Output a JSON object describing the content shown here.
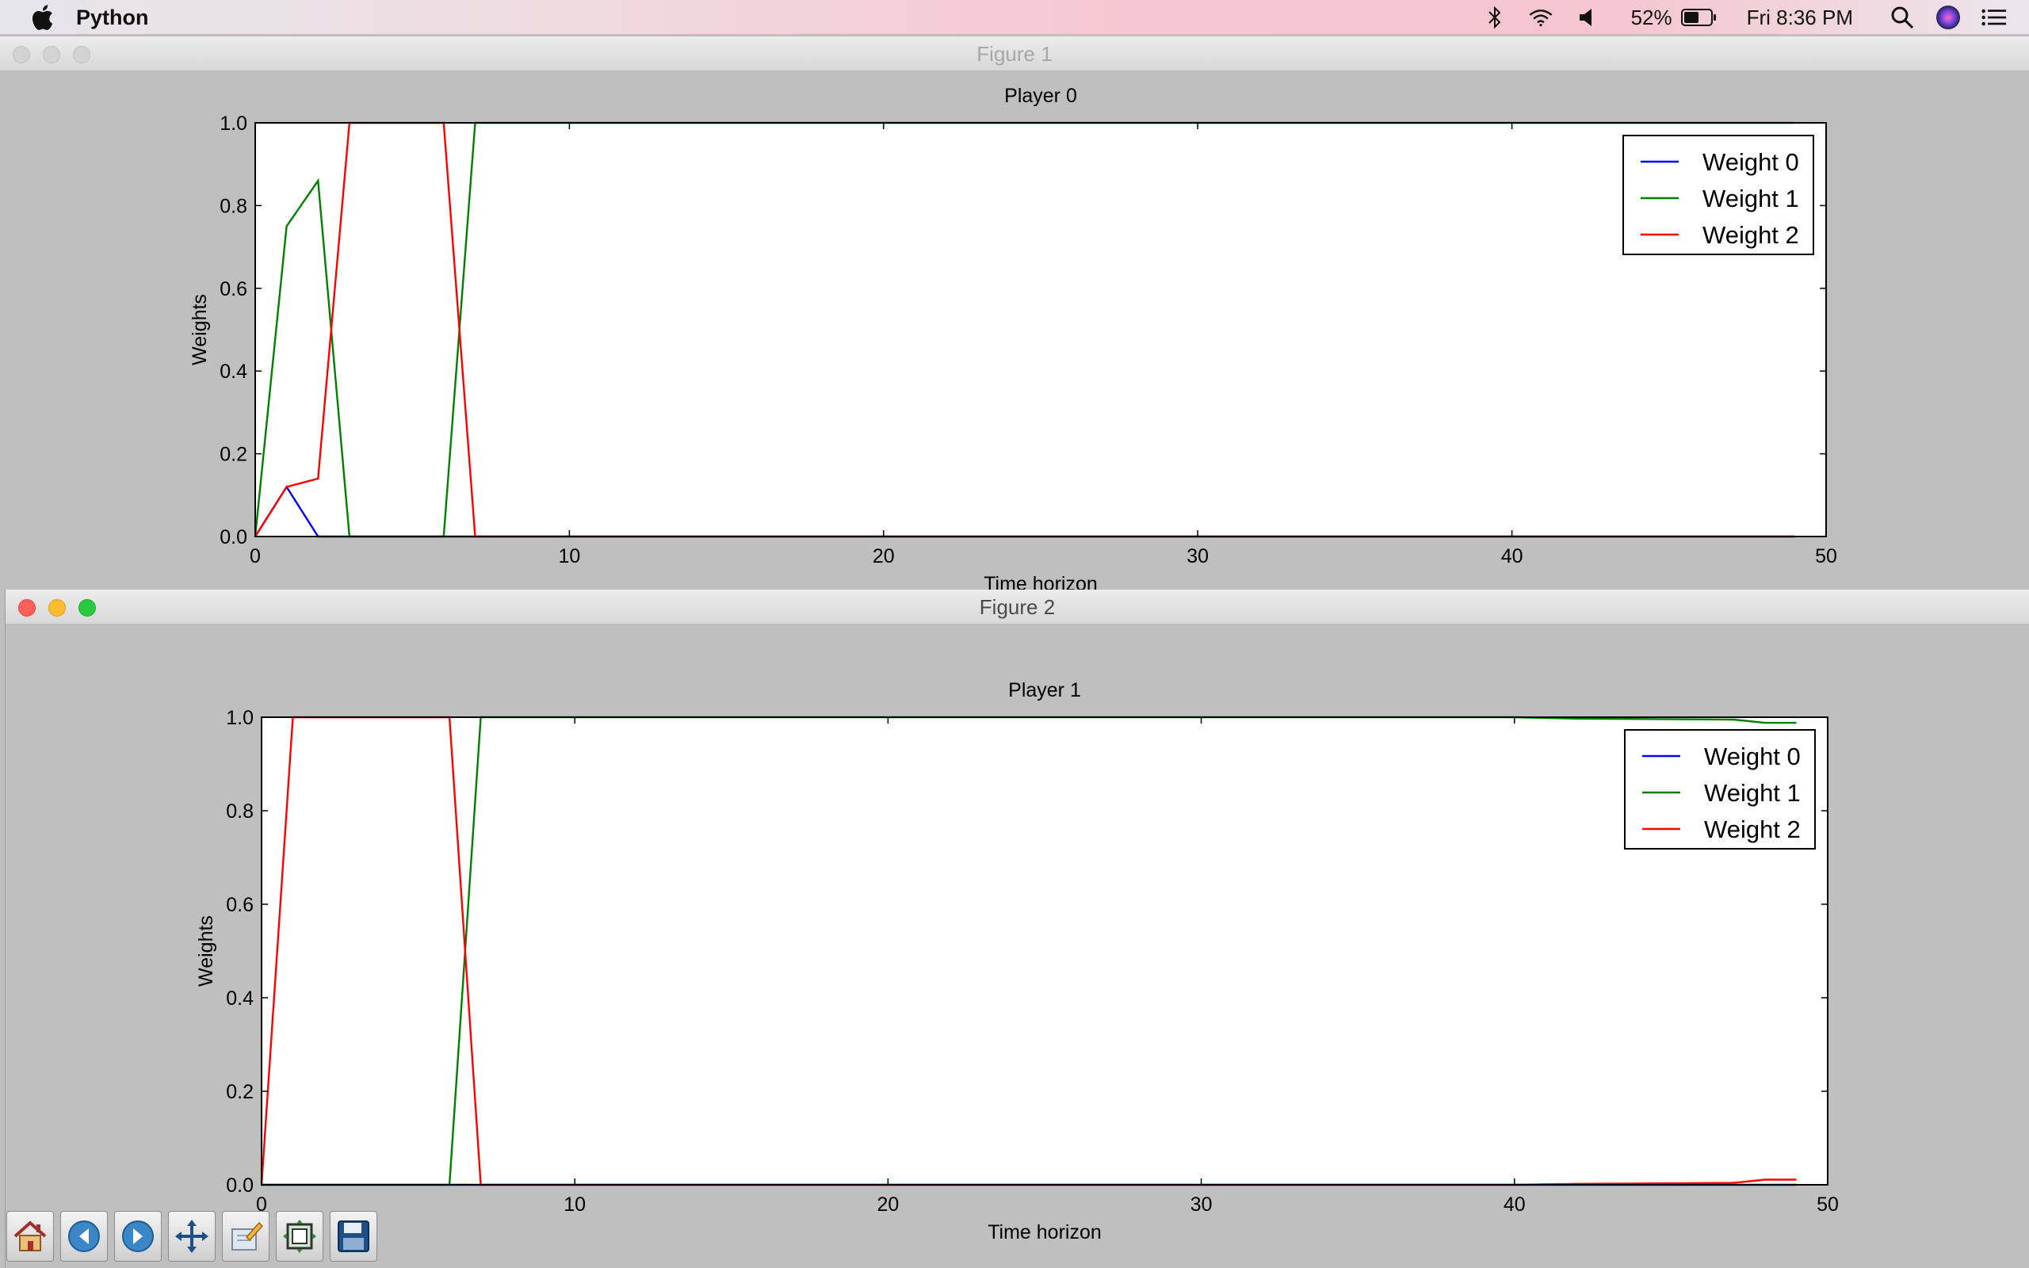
{
  "menubar": {
    "app_name": "Python",
    "battery": "52%",
    "clock": "Fri 8:36 PM",
    "icons": [
      "apple-icon",
      "bluetooth-icon",
      "wifi-icon",
      "volume-icon",
      "battery-icon",
      "spotlight-icon",
      "siri-icon",
      "notification-center-icon"
    ]
  },
  "figure1": {
    "window_title": "Figure 1",
    "chart_data": {
      "type": "line",
      "title": "Player 0",
      "xlabel": "Time horizon",
      "ylabel": "Weights",
      "xlim": [
        0,
        50
      ],
      "ylim": [
        0,
        1
      ],
      "x_ticks": [
        "0",
        "10",
        "20",
        "30",
        "40",
        "50"
      ],
      "y_ticks": [
        "0.0",
        "0.2",
        "0.4",
        "0.6",
        "0.8",
        "1.0"
      ],
      "legend_position": "top-right",
      "series": [
        {
          "name": "Weight 0",
          "color": "#0000ff",
          "x": [
            0,
            1,
            2,
            3,
            49
          ],
          "y": [
            0,
            0.12,
            0,
            0,
            0
          ]
        },
        {
          "name": "Weight 1",
          "color": "#008000",
          "x": [
            0,
            1,
            2,
            3,
            6,
            7,
            49
          ],
          "y": [
            0,
            0.75,
            0.86,
            0,
            0,
            1,
            1
          ]
        },
        {
          "name": "Weight 2",
          "color": "#ff0000",
          "x": [
            0,
            1,
            2,
            3,
            6,
            7,
            49
          ],
          "y": [
            0,
            0.12,
            0.14,
            1,
            1,
            0,
            0
          ]
        }
      ]
    }
  },
  "figure2": {
    "window_title": "Figure 2",
    "chart_data": {
      "type": "line",
      "title": "Player 1",
      "xlabel": "Time horizon",
      "ylabel": "Weights",
      "xlim": [
        0,
        50
      ],
      "ylim": [
        0,
        1
      ],
      "x_ticks": [
        "0",
        "10",
        "20",
        "30",
        "40",
        "50"
      ],
      "y_ticks": [
        "0.0",
        "0.2",
        "0.4",
        "0.6",
        "0.8",
        "1.0"
      ],
      "legend_position": "top-right",
      "series": [
        {
          "name": "Weight 0",
          "color": "#0000ff",
          "x": [
            0,
            49
          ],
          "y": [
            0,
            0
          ]
        },
        {
          "name": "Weight 1",
          "color": "#008000",
          "x": [
            0,
            1,
            6,
            7,
            40,
            42,
            47,
            48,
            49
          ],
          "y": [
            0,
            0,
            0,
            1,
            1,
            0.997,
            0.995,
            0.988,
            0.988
          ]
        },
        {
          "name": "Weight 2",
          "color": "#ff0000",
          "x": [
            0,
            1,
            6,
            7,
            40,
            42,
            47,
            48,
            49
          ],
          "y": [
            0,
            1,
            1,
            0,
            0,
            0.002,
            0.004,
            0.011,
            0.011
          ]
        }
      ]
    }
  },
  "toolbar": {
    "buttons": [
      {
        "name": "home-button",
        "icon": "home-icon"
      },
      {
        "name": "back-button",
        "icon": "back-arrow-icon"
      },
      {
        "name": "forward-button",
        "icon": "forward-arrow-icon"
      },
      {
        "name": "pan-button",
        "icon": "pan-icon"
      },
      {
        "name": "zoom-button",
        "icon": "zoom-rect-icon"
      },
      {
        "name": "subplots-button",
        "icon": "subplots-icon"
      },
      {
        "name": "save-button",
        "icon": "save-icon"
      }
    ]
  }
}
